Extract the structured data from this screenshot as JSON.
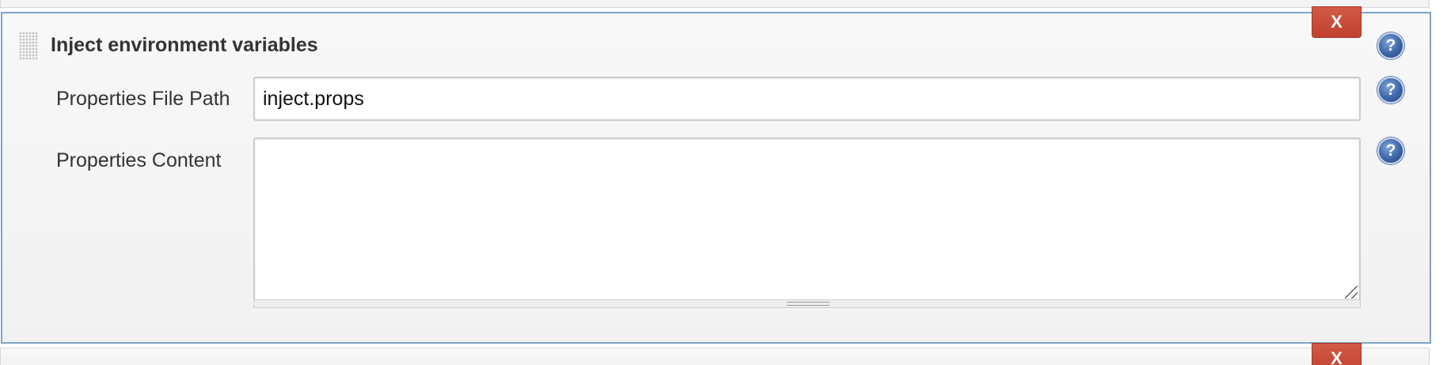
{
  "section": {
    "title": "Inject environment variables",
    "delete_label": "X"
  },
  "fields": {
    "properties_file_path": {
      "label": "Properties File Path",
      "value": "inject.props"
    },
    "properties_content": {
      "label": "Properties Content",
      "value": ""
    }
  },
  "help_label": "?",
  "next_section": {
    "delete_label": "X"
  },
  "colors": {
    "delete_button": "#c8483a",
    "section_border": "#7fa3c8",
    "help_icon": "#3d66a8"
  },
  "icons": [
    "drag-handle-icon",
    "help-icon",
    "close-icon",
    "resize-grip-icon"
  ]
}
